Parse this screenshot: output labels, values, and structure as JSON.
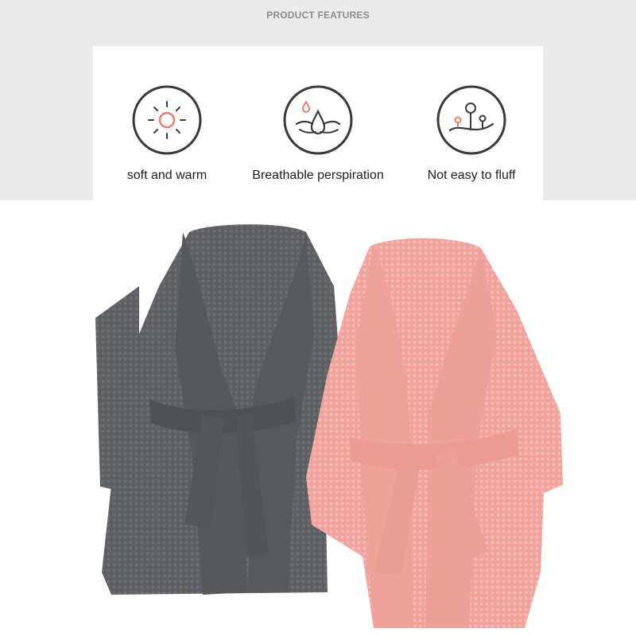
{
  "section_title": "PRODUCT FEATURES",
  "features": [
    {
      "label": "soft and warm",
      "icon": "sun-icon"
    },
    {
      "label": "Breathable perspiration",
      "icon": "water-drop-icon"
    },
    {
      "label": "Not easy to fluff",
      "icon": "fuzz-ball-icon"
    }
  ],
  "colors": {
    "accent": "#f07d70",
    "icon_stroke": "#3a3a3a",
    "band_background": "#ebebeb",
    "gray_robe": "#5d5f63",
    "pink_robe": "#f2aaa4"
  }
}
